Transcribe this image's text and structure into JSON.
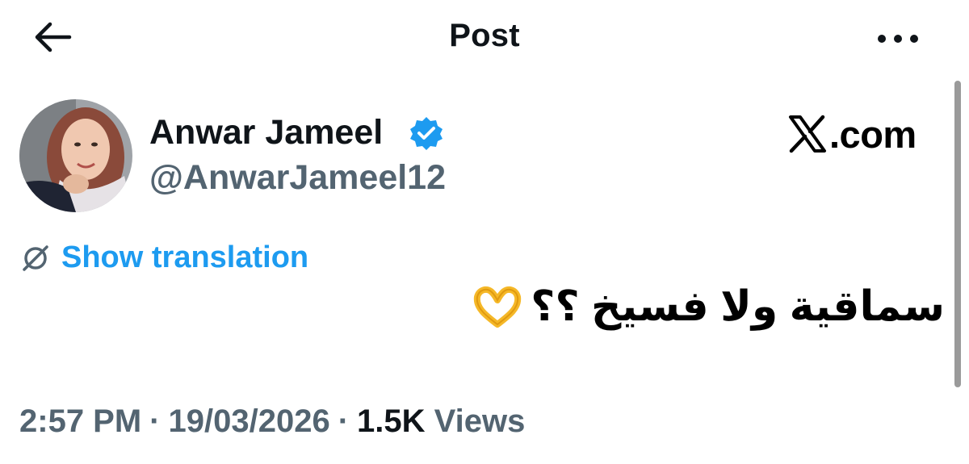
{
  "header": {
    "title": "Post",
    "back_icon": "arrow-left-icon",
    "more_icon": "more-horizontal-icon"
  },
  "author": {
    "display_name": "Anwar Jameel",
    "handle": "@AnwarJameel12",
    "verified_icon": "verified-badge-icon",
    "verified_color": "#1d9bf0"
  },
  "brand": {
    "text": ".com",
    "logo_icon": "x-logo-icon"
  },
  "translation": {
    "label": "Show translation",
    "icon": "globe-slash-icon",
    "color": "#1d9bf0"
  },
  "post": {
    "text": "سماقية ولا فسيخ ؟؟",
    "emoji_icon": "heart-hands-emoji"
  },
  "meta": {
    "time": "2:57 PM",
    "date": "19/03/2026",
    "separator": "·",
    "views_count": "1.5K",
    "views_label": "Views"
  },
  "colors": {
    "text_primary": "#0f1419",
    "text_secondary": "#536471",
    "accent": "#1d9bf0"
  }
}
